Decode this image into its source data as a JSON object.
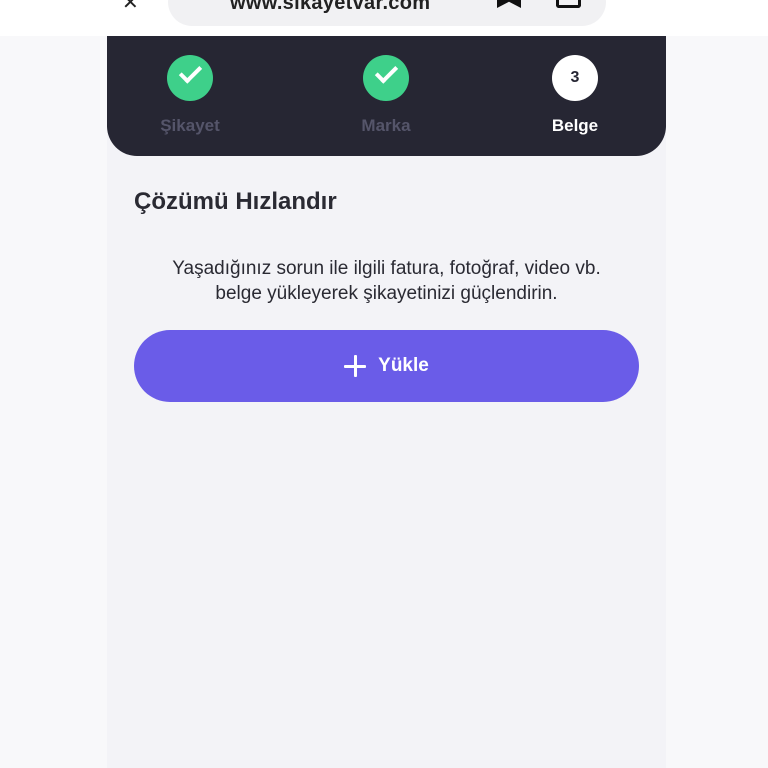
{
  "browser": {
    "url": "www.sikayetvar.com"
  },
  "stepper": {
    "steps": [
      {
        "label": "Şikayet",
        "state": "done"
      },
      {
        "label": "Marka",
        "state": "done"
      },
      {
        "label": "Belge",
        "state": "active",
        "number": "3"
      }
    ]
  },
  "main": {
    "title": "Çözümü Hızlandır",
    "description_line1": "Yaşadığınız sorun ile ilgili fatura, fotoğraf, video vb.",
    "description_line2": "belge yükleyerek şikayetinizi güçlendirin.",
    "upload_label": "Yükle"
  },
  "colors": {
    "header_bg": "#262633",
    "done_green": "#3ed08a",
    "accent_purple": "#6a5ce8"
  }
}
